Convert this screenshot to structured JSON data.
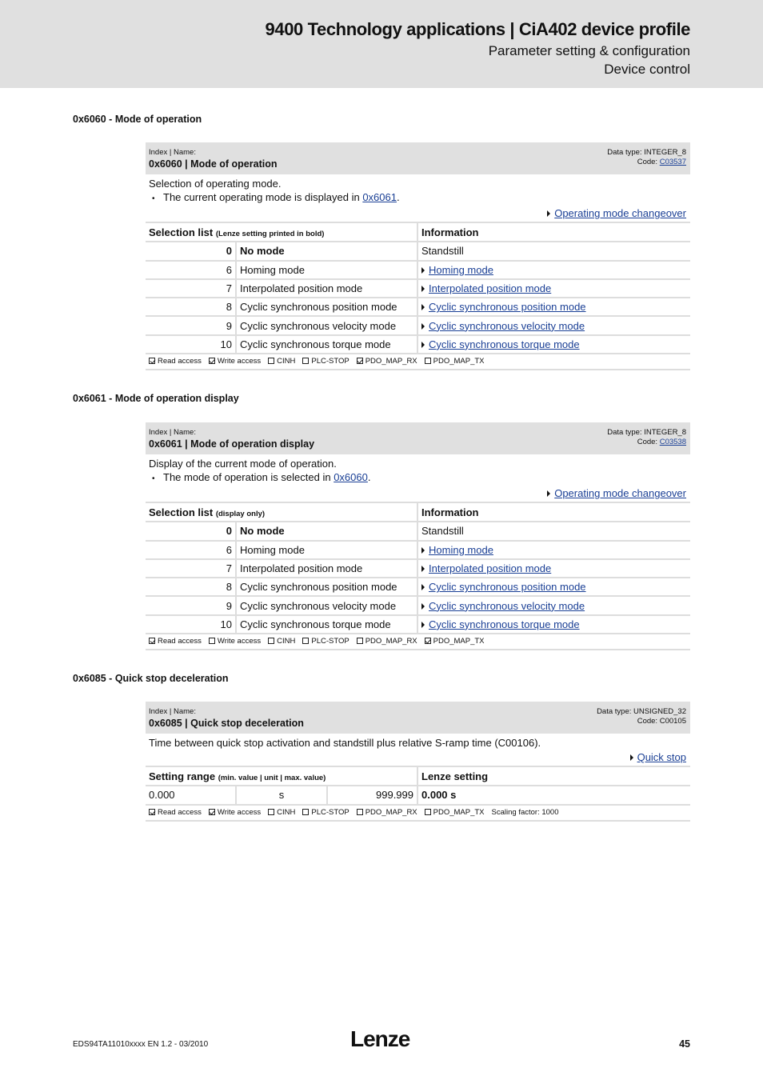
{
  "header": {
    "title": "9400 Technology applications | CiA402 device profile",
    "subtitle1": "Parameter setting & configuration",
    "subtitle2": "Device control"
  },
  "sections": [
    {
      "heading": "0x6060 - Mode of operation",
      "index_label": "Index | Name:",
      "name": "0x6060 | Mode of operation",
      "data_type": "Data type: INTEGER_8",
      "code_label": "Code: ",
      "code_value": "C03537",
      "description": "Selection of operating mode.",
      "bullet_prefix": "The current operating mode is displayed in ",
      "bullet_link": "0x6061",
      "bullet_suffix": ".",
      "xref": "Operating mode changeover",
      "table_header_left": "Selection list ",
      "table_header_left_note": "(Lenze setting printed in bold)",
      "table_header_right": "Information",
      "rows": [
        {
          "value": "0",
          "label": "No mode",
          "info": "Standstill",
          "is_link": false,
          "bold": true
        },
        {
          "value": "6",
          "label": "Homing mode",
          "info": "Homing mode",
          "is_link": true,
          "bold": false
        },
        {
          "value": "7",
          "label": "Interpolated position mode",
          "info": "Interpolated position mode",
          "is_link": true,
          "bold": false
        },
        {
          "value": "8",
          "label": "Cyclic synchronous position mode",
          "info": "Cyclic synchronous position mode",
          "is_link": true,
          "bold": false
        },
        {
          "value": "9",
          "label": "Cyclic synchronous velocity mode",
          "info": "Cyclic synchronous velocity mode",
          "is_link": true,
          "bold": false
        },
        {
          "value": "10",
          "label": "Cyclic synchronous torque mode",
          "info": "Cyclic synchronous torque mode",
          "is_link": true,
          "bold": false
        }
      ],
      "access": [
        {
          "label": "Read access",
          "checked": true
        },
        {
          "label": "Write access",
          "checked": true
        },
        {
          "label": "CINH",
          "checked": false
        },
        {
          "label": "PLC-STOP",
          "checked": false
        },
        {
          "label": "PDO_MAP_RX",
          "checked": true
        },
        {
          "label": "PDO_MAP_TX",
          "checked": false
        }
      ]
    },
    {
      "heading": "0x6061 - Mode of operation display",
      "index_label": "Index | Name:",
      "name": "0x6061 | Mode of operation display",
      "data_type": "Data type: INTEGER_8",
      "code_label": "Code: ",
      "code_value": "C03538",
      "description": "Display of the current mode of operation.",
      "bullet_prefix": "The mode of operation is selected in ",
      "bullet_link": "0x6060",
      "bullet_suffix": ".",
      "xref": "Operating mode changeover",
      "table_header_left": "Selection list ",
      "table_header_left_note": "(display only)",
      "table_header_right": "Information",
      "rows": [
        {
          "value": "0",
          "label": "No mode",
          "info": "Standstill",
          "is_link": false,
          "bold": true
        },
        {
          "value": "6",
          "label": "Homing mode",
          "info": "Homing mode",
          "is_link": true,
          "bold": false
        },
        {
          "value": "7",
          "label": "Interpolated position mode",
          "info": "Interpolated position mode",
          "is_link": true,
          "bold": false
        },
        {
          "value": "8",
          "label": "Cyclic synchronous position mode",
          "info": "Cyclic synchronous position mode",
          "is_link": true,
          "bold": false
        },
        {
          "value": "9",
          "label": "Cyclic synchronous velocity mode",
          "info": "Cyclic synchronous velocity mode",
          "is_link": true,
          "bold": false
        },
        {
          "value": "10",
          "label": "Cyclic synchronous torque mode",
          "info": "Cyclic synchronous torque mode",
          "is_link": true,
          "bold": false
        }
      ],
      "access": [
        {
          "label": "Read access",
          "checked": true
        },
        {
          "label": "Write access",
          "checked": false
        },
        {
          "label": "CINH",
          "checked": false
        },
        {
          "label": "PLC-STOP",
          "checked": false
        },
        {
          "label": "PDO_MAP_RX",
          "checked": false
        },
        {
          "label": "PDO_MAP_TX",
          "checked": true
        }
      ]
    },
    {
      "heading": "0x6085 - Quick stop deceleration",
      "index_label": "Index | Name:",
      "name": "0x6085 | Quick stop deceleration",
      "data_type": "Data type: UNSIGNED_32",
      "code_text": "Code: C00105",
      "description": "Time between quick stop activation and standstill plus relative S-ramp time (C00106).",
      "xref": "Quick stop",
      "table_header_left": "Setting range ",
      "table_header_left_note": "(min. value | unit | max. value)",
      "table_header_right": "Lenze setting",
      "range": {
        "min": "0.000",
        "unit": "s",
        "max": "999.999",
        "lenze_setting": "0.000 s"
      },
      "access": [
        {
          "label": "Read access",
          "checked": true
        },
        {
          "label": "Write access",
          "checked": true
        },
        {
          "label": "CINH",
          "checked": false
        },
        {
          "label": "PLC-STOP",
          "checked": false
        },
        {
          "label": "PDO_MAP_RX",
          "checked": false
        },
        {
          "label": "PDO_MAP_TX",
          "checked": false
        }
      ],
      "scaling": "Scaling factor: 1000"
    }
  ],
  "footer": {
    "doc_id": "EDS94TA11010xxxx EN 1.2 - 03/2010",
    "logo": "Lenze",
    "page": "45"
  }
}
